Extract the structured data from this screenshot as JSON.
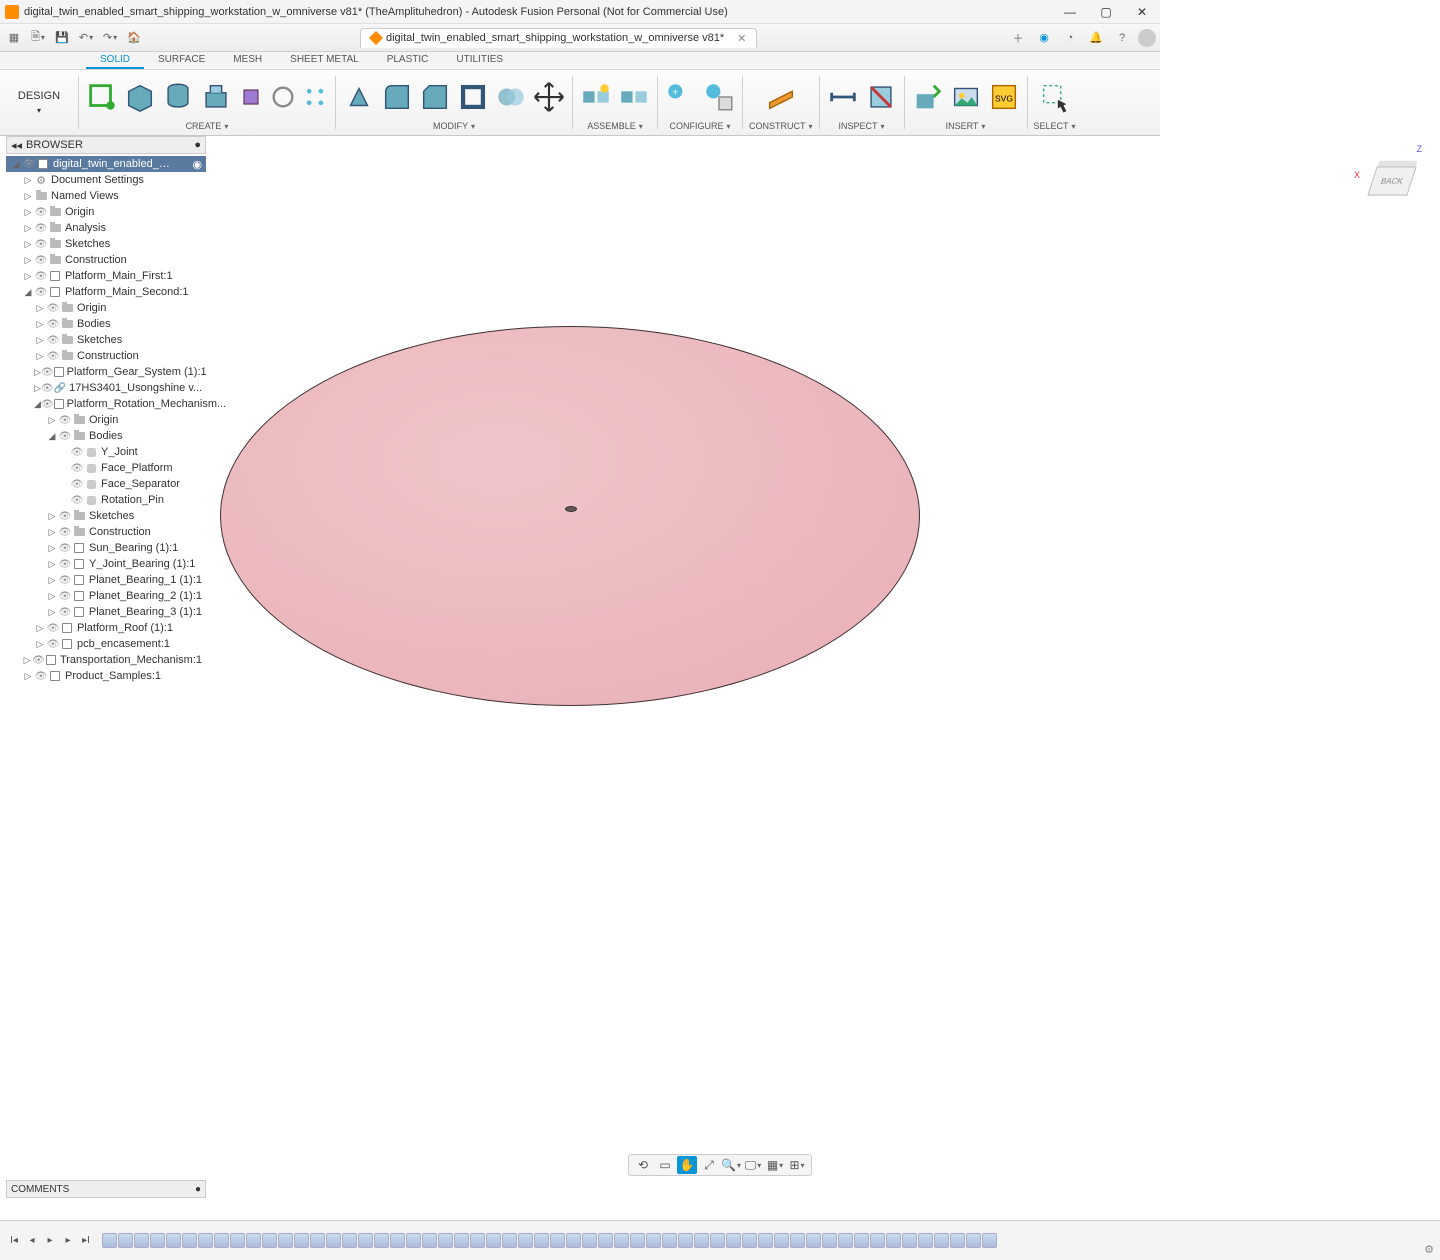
{
  "window": {
    "title": "digital_twin_enabled_smart_shipping_workstation_w_omniverse v81* (TheAmplituhedron) - Autodesk Fusion Personal (Not for Commercial Use)"
  },
  "doc_tab": {
    "label": "digital_twin_enabled_smart_shipping_workstation_w_omniverse v81*"
  },
  "workspace": {
    "button": "DESIGN",
    "tabs": [
      "SOLID",
      "SURFACE",
      "MESH",
      "SHEET METAL",
      "PLASTIC",
      "UTILITIES"
    ],
    "active": 0
  },
  "ribbon": {
    "create": "CREATE",
    "modify": "MODIFY",
    "assemble": "ASSEMBLE",
    "configure": "CONFIGURE",
    "construct": "CONSTRUCT",
    "inspect": "INSPECT",
    "insert": "INSERT",
    "select": "SELECT"
  },
  "browser": {
    "title": "BROWSER",
    "root": "digital_twin_enabled_smart_s...",
    "nodes": {
      "doc_settings": "Document Settings",
      "named_views": "Named Views",
      "origin": "Origin",
      "analysis": "Analysis",
      "sketches": "Sketches",
      "construction": "Construction",
      "plat_first": "Platform_Main_First:1",
      "plat_second": "Platform_Main_Second:1",
      "p2_origin": "Origin",
      "p2_bodies": "Bodies",
      "p2_sketches": "Sketches",
      "p2_constr": "Construction",
      "gear": "Platform_Gear_System (1):1",
      "stepper": "17HS3401_Usongshine v...",
      "rotmech": "Platform_Rotation_Mechanism...",
      "rm_origin": "Origin",
      "rm_bodies": "Bodies",
      "y_joint": "Y_Joint",
      "face_plat": "Face_Platform",
      "face_sep": "Face_Separator",
      "rot_pin": "Rotation_Pin",
      "rm_sketches": "Sketches",
      "rm_constr": "Construction",
      "sun_bear": "Sun_Bearing (1):1",
      "yj_bear": "Y_Joint_Bearing (1):1",
      "pb1": "Planet_Bearing_1 (1):1",
      "pb2": "Planet_Bearing_2 (1):1",
      "pb3": "Planet_Bearing_3 (1):1",
      "roof": "Platform_Roof (1):1",
      "pcb": "pcb_encasement:1",
      "transport": "Transportation_Mechanism:1",
      "samples": "Product_Samples:1"
    }
  },
  "viewcube": {
    "face": "BACK",
    "x": "X",
    "z": "Z"
  },
  "comments": {
    "label": "COMMENTS"
  },
  "timeline_count": 56
}
